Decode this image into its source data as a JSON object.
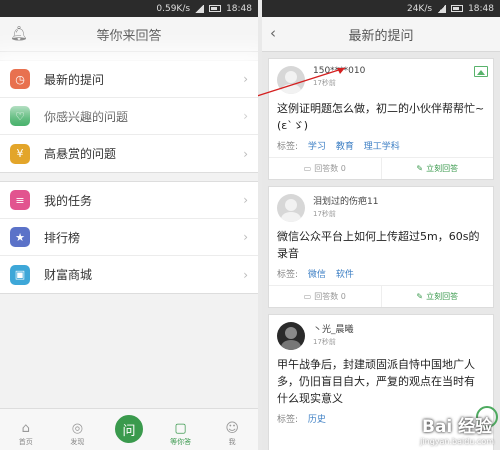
{
  "left_status": {
    "speed": "0.59K/s",
    "time": "18:48"
  },
  "right_status": {
    "speed": "24K/s",
    "time": "18:48"
  },
  "left_title": "等你来回答",
  "menu_group1": [
    {
      "label": "最新的提问",
      "icon": "clock-icon",
      "color": "#e8714f"
    },
    {
      "label": "你感兴趣的问题",
      "icon": "heart-icon",
      "color": "#3fae64"
    },
    {
      "label": "高悬赏的问题",
      "icon": "coin-icon",
      "color": "#e3a52a"
    }
  ],
  "menu_group2": [
    {
      "label": "我的任务",
      "icon": "task-icon",
      "color": "#e2548f"
    },
    {
      "label": "排行榜",
      "icon": "trophy-icon",
      "color": "#5b72c8"
    },
    {
      "label": "财富商城",
      "icon": "gift-icon",
      "color": "#3ea7d8"
    }
  ],
  "tabs": [
    {
      "label": "首页",
      "icon": "home-icon"
    },
    {
      "label": "发现",
      "icon": "compass-icon"
    },
    {
      "label": "问",
      "icon": "ask-icon"
    },
    {
      "label": "等你答",
      "icon": "answer-icon"
    },
    {
      "label": "我",
      "icon": "user-icon"
    }
  ],
  "right_title": "最新的提问",
  "questions": [
    {
      "user": "150****010",
      "time": "17秒前",
      "text": "这例证明题怎么做，初二的小伙伴帮帮忙~(ε`ゞ)",
      "tags_label": "标签:",
      "tags": [
        "学习",
        "教育",
        "理工学科"
      ],
      "answers": "回答数 0",
      "answer_btn": "立刻回答"
    },
    {
      "user": "泪划过的伤疤11",
      "time": "17秒前",
      "text": "微信公众平台上如何上传超过5m，60s的录音",
      "tags_label": "标签:",
      "tags": [
        "微信",
        "软件"
      ],
      "answers": "回答数 0",
      "answer_btn": "立刻回答"
    },
    {
      "user": "丶光_晨曦",
      "time": "17秒前",
      "text": "甲午战争后，封建顽固派自恃中国地广人多，仍旧盲目自大，严复的观点在当时有什么现实意义",
      "tags_label": "标签:",
      "tags": [
        "历史"
      ]
    }
  ],
  "watermark": {
    "logo": "Bai 经验",
    "url": "jingyan.baidu.com"
  }
}
